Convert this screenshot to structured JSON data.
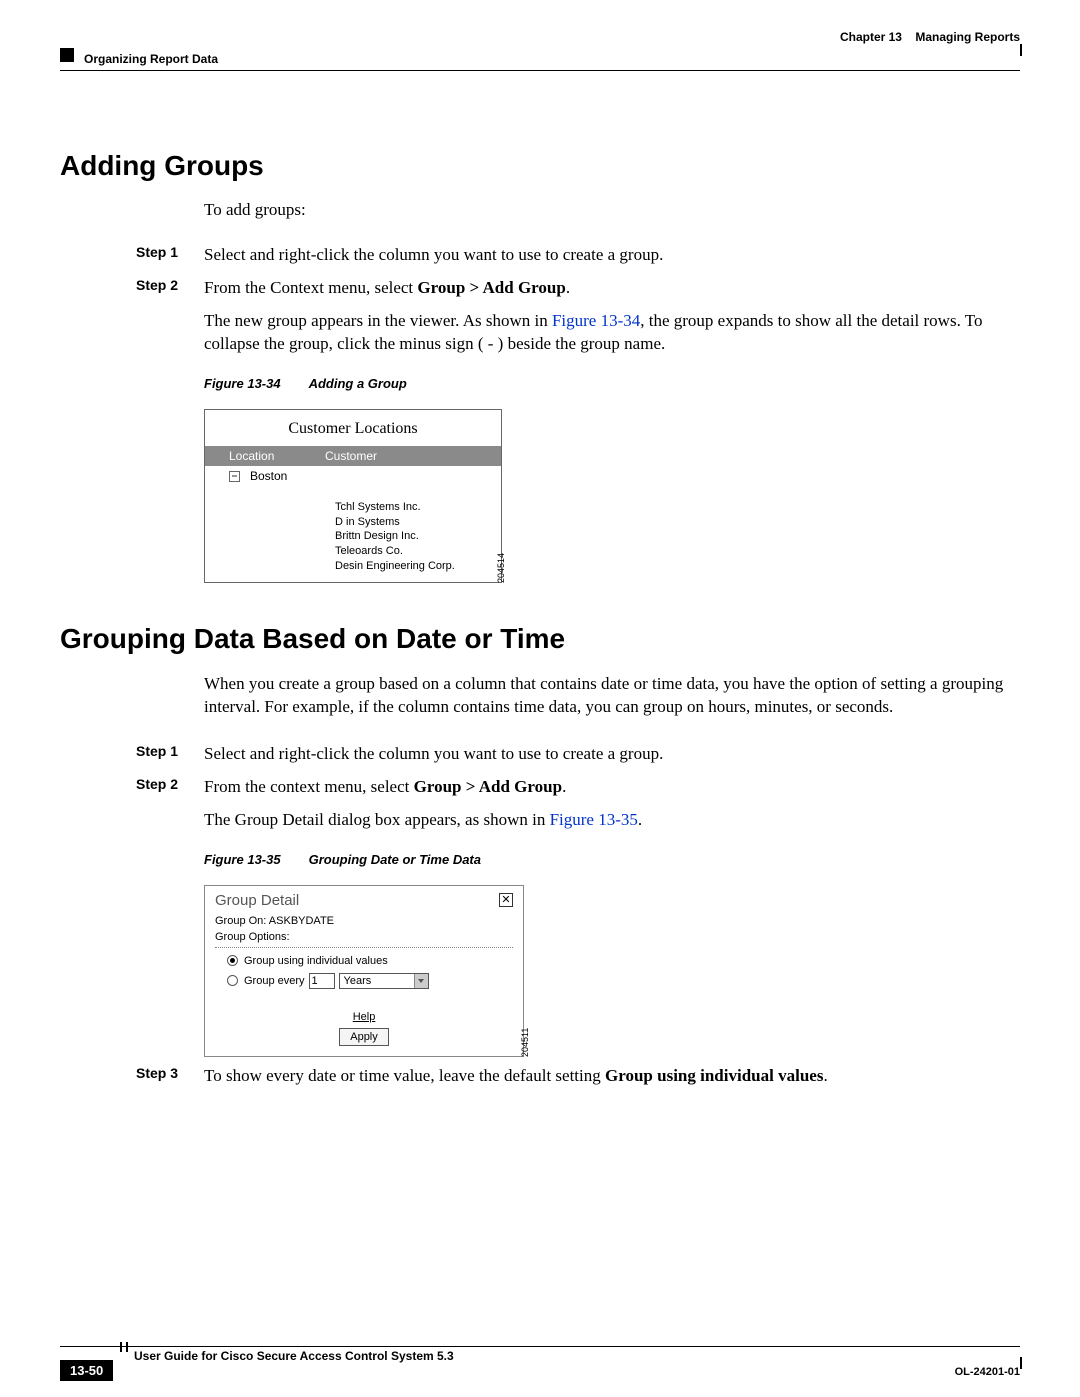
{
  "header": {
    "chapter_num": "Chapter 13",
    "chapter_title": "Managing Reports",
    "section": "Organizing Report Data"
  },
  "h1a": "Adding Groups",
  "intro_a": "To add groups:",
  "steps_a": [
    {
      "label": "Step 1",
      "body": "Select and right-click the column you want to use to create a group."
    },
    {
      "label": "Step 2",
      "body_prefix": "From the Context menu, select ",
      "bold1": "Group > Add Group",
      "body_suffix": "."
    }
  ],
  "cont_a_1": "The new group appears in the viewer. As shown in ",
  "cont_a_link": "Figure 13-34",
  "cont_a_2": ", the group expands to show all the detail rows. To collapse the group, click the minus sign ( - ) beside the group name.",
  "figcap_a_num": "Figure 13-34",
  "figcap_a_txt": "Adding a Group",
  "fig34": {
    "title": "Customer Locations",
    "col1": "Location",
    "col2": "Customer",
    "loc": "Boston",
    "items": [
      "Tchl Systems Inc.",
      "D   in Systems",
      "Brittn Design Inc.",
      "Teleoards Co.",
      "Desin Engineering Corp."
    ],
    "sideid": "204514"
  },
  "h1b": "Grouping Data Based on Date or Time",
  "intro_b": "When you create a group based on a column that contains date or time data, you have the option of setting a grouping interval. For example, if the column contains time data, you can group on hours, minutes, or seconds.",
  "steps_b": [
    {
      "label": "Step 1",
      "body": "Select and right-click the column you want to use to create a group."
    },
    {
      "label": "Step 2",
      "body_prefix": "From the context menu, select ",
      "bold1": "Group > Add Group",
      "body_suffix": "."
    }
  ],
  "cont_b_1": "The Group Detail dialog box appears, as shown in ",
  "cont_b_link": "Figure 13-35",
  "cont_b_2": ".",
  "figcap_b_num": "Figure 13-35",
  "figcap_b_txt": "Grouping Date or Time Data",
  "fig35": {
    "title": "Group Detail",
    "close": "✕",
    "line1": "Group On: ASKBYDATE",
    "line2": "Group Options:",
    "opt1": "Group using individual values",
    "opt2_prefix": "Group every",
    "opt2_num": "1",
    "opt2_unit": "Years",
    "help": "Help",
    "apply": "Apply",
    "sideid": "204511"
  },
  "step3": {
    "label": "Step 3",
    "body_prefix": "To show every date or time value, leave the default setting ",
    "bold1": "Group using individual values",
    "body_suffix": "."
  },
  "footer": {
    "guide": "User Guide for Cisco Secure Access Control System 5.3",
    "page": "13-50",
    "docid": "OL-24201-01"
  }
}
